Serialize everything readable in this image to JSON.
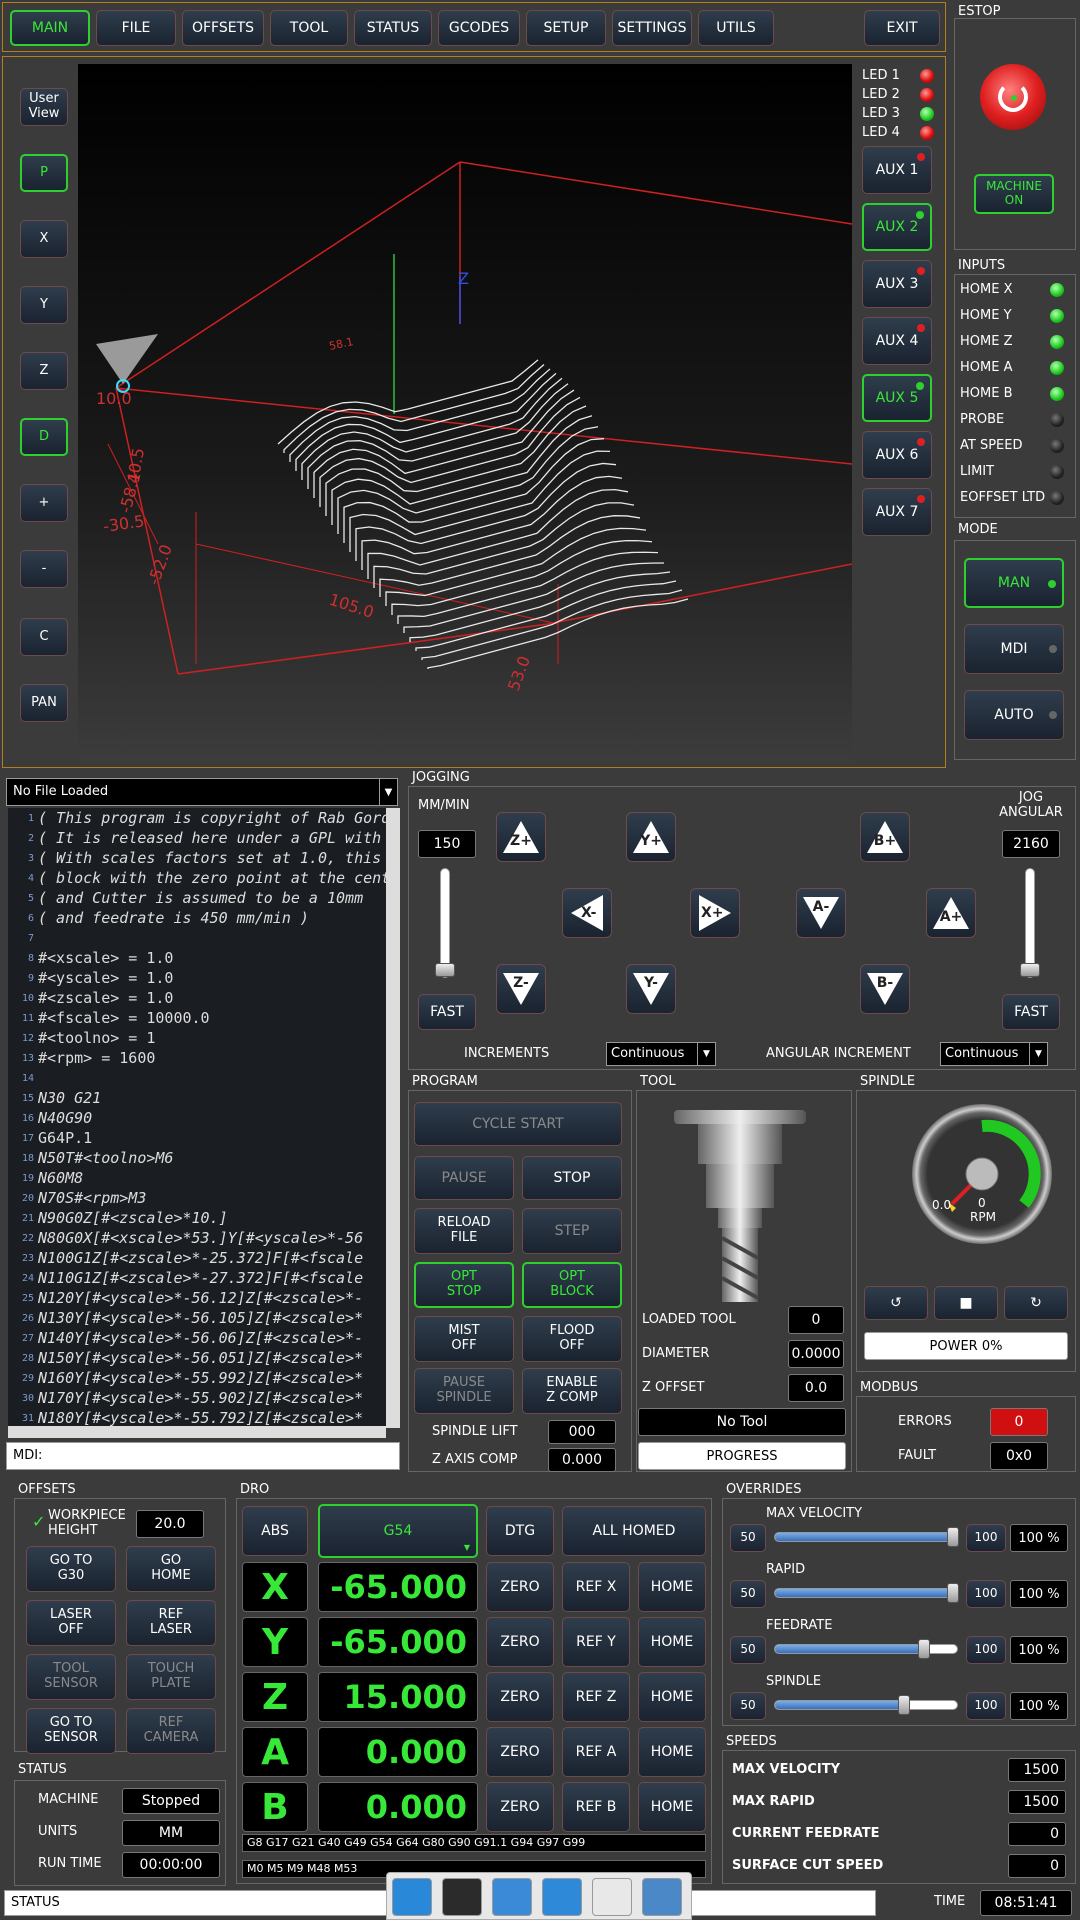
{
  "tabs": [
    "MAIN",
    "FILE",
    "OFFSETS",
    "TOOL",
    "STATUS",
    "GCODES",
    "SETUP",
    "SETTINGS",
    "UTILS"
  ],
  "exit_label": "EXIT",
  "estop": {
    "title": "ESTOP",
    "machine_on": "MACHINE\nON"
  },
  "view_buttons": [
    "User\nView",
    "P",
    "X",
    "Y",
    "Z",
    "D",
    "+",
    "-",
    "C",
    "PAN"
  ],
  "leds": [
    {
      "label": "LED 1",
      "state": "red"
    },
    {
      "label": "LED 2",
      "state": "red"
    },
    {
      "label": "LED 3",
      "state": "green"
    },
    {
      "label": "LED 4",
      "state": "red"
    }
  ],
  "aux": [
    {
      "label": "AUX 1",
      "on": false
    },
    {
      "label": "AUX 2",
      "on": true
    },
    {
      "label": "AUX 3",
      "on": false
    },
    {
      "label": "AUX 4",
      "on": false
    },
    {
      "label": "AUX 5",
      "on": true
    },
    {
      "label": "AUX 6",
      "on": false
    },
    {
      "label": "AUX 7",
      "on": false
    }
  ],
  "preview": {
    "labels": [
      "10.0",
      "58.1",
      "40.5",
      "-58.1",
      "-30.5",
      "-52.0",
      "105.0",
      "53.0",
      "Z",
      "X",
      "Y"
    ]
  },
  "inputs": {
    "title": "INPUTS",
    "items": [
      {
        "label": "HOME X",
        "state": "green"
      },
      {
        "label": "HOME Y",
        "state": "green"
      },
      {
        "label": "HOME Z",
        "state": "green"
      },
      {
        "label": "HOME A",
        "state": "green"
      },
      {
        "label": "HOME B",
        "state": "green"
      },
      {
        "label": "PROBE",
        "state": "off"
      },
      {
        "label": "AT SPEED",
        "state": "off"
      },
      {
        "label": "LIMIT",
        "state": "off"
      },
      {
        "label": "EOFFSET LTD",
        "state": "off"
      }
    ]
  },
  "mode": {
    "title": "MODE",
    "items": [
      {
        "label": "MAN",
        "on": true
      },
      {
        "label": "MDI",
        "on": false
      },
      {
        "label": "AUTO",
        "on": false
      }
    ]
  },
  "file": {
    "selected": "No File Loaded"
  },
  "gcode_lines": [
    {
      "n": "1",
      "t": "( This program is copyright of Rab Gordon"
    },
    {
      "n": "2",
      "t": "( It is released here under a GPL with"
    },
    {
      "n": "3",
      "t": "( With scales factors set at 1.0, this"
    },
    {
      "n": "4",
      "t": "( block with the zero point at the centre"
    },
    {
      "n": "5",
      "t": "( and Cutter is assumed to be a 10mm"
    },
    {
      "n": "6",
      "t": "( and feedrate is 450 mm/min )"
    },
    {
      "n": "7",
      "t": ""
    },
    {
      "n": "8",
      "t": "#<xscale> = 1.0"
    },
    {
      "n": "9",
      "t": "#<yscale> = 1.0"
    },
    {
      "n": "10",
      "t": "#<zscale> = 1.0"
    },
    {
      "n": "11",
      "t": "#<fscale> = 10000.0"
    },
    {
      "n": "12",
      "t": "#<toolno> = 1"
    },
    {
      "n": "13",
      "t": "#<rpm>    = 1600"
    },
    {
      "n": "14",
      "t": ""
    },
    {
      "n": "15",
      "t": "N30 G21"
    },
    {
      "n": "16",
      "t": "N40G90"
    },
    {
      "n": "17",
      "t": "G64P.1"
    },
    {
      "n": "18",
      "t": "N50T#<toolno>M6"
    },
    {
      "n": "19",
      "t": "N60M8"
    },
    {
      "n": "20",
      "t": "N70S#<rpm>M3"
    },
    {
      "n": "21",
      "t": "N90G0Z[#<zscale>*10.]"
    },
    {
      "n": "22",
      "t": "N80G0X[#<xscale>*53.]Y[#<yscale>*-56"
    },
    {
      "n": "23",
      "t": "N100G1Z[#<zscale>*-25.372]F[#<fscale"
    },
    {
      "n": "24",
      "t": "N110G1Z[#<zscale>*-27.372]F[#<fscale"
    },
    {
      "n": "25",
      "t": "N120Y[#<yscale>*-56.12]Z[#<zscale>*-"
    },
    {
      "n": "26",
      "t": "N130Y[#<yscale>*-56.105]Z[#<zscale>*"
    },
    {
      "n": "27",
      "t": "N140Y[#<yscale>*-56.06]Z[#<zscale>*-"
    },
    {
      "n": "28",
      "t": "N150Y[#<yscale>*-56.051]Z[#<zscale>*"
    },
    {
      "n": "29",
      "t": "N160Y[#<yscale>*-55.992]Z[#<zscale>*"
    },
    {
      "n": "30",
      "t": "N170Y[#<yscale>*-55.902]Z[#<zscale>*"
    },
    {
      "n": "31",
      "t": "N180Y[#<yscale>*-55.792]Z[#<zscale>*"
    }
  ],
  "mdi": {
    "label": "MDI:"
  },
  "jogging": {
    "title": "JOGGING",
    "units": "MM/MIN",
    "rate": "150",
    "ang_title": "JOG\nANGULAR",
    "ang_rate": "2160",
    "fast": "FAST",
    "increments_label": "INCREMENTS",
    "increments_value": "Continuous",
    "ang_inc_label": "ANGULAR INCREMENT",
    "ang_inc_value": "Continuous",
    "buttons": {
      "zp": "Z+",
      "yp": "Y+",
      "bp": "B+",
      "xm": "X-",
      "xp": "X+",
      "am": "A-",
      "ap": "A+",
      "zm": "Z-",
      "ym": "Y-",
      "bm": "B-"
    }
  },
  "program": {
    "title": "PROGRAM",
    "cycle_start": "CYCLE START",
    "pause": "PAUSE",
    "stop": "STOP",
    "reload": "RELOAD\nFILE",
    "step": "STEP",
    "opt_stop": "OPT\nSTOP",
    "opt_block": "OPT\nBLOCK",
    "mist": "MIST\nOFF",
    "flood": "FLOOD\nOFF",
    "pause_spindle": "PAUSE\nSPINDLE",
    "enable_zcomp": "ENABLE\nZ COMP",
    "spindle_lift_label": "SPINDLE LIFT",
    "spindle_lift": "000",
    "zcomp_label": "Z AXIS COMP",
    "zcomp": "0.000"
  },
  "tool": {
    "title": "TOOL",
    "loaded_label": "LOADED TOOL",
    "loaded": "0",
    "diameter_label": "DIAMETER",
    "diameter": "0.0000",
    "zoffset_label": "Z OFFSET",
    "zoffset": "0.0",
    "no_tool": "No Tool",
    "progress": "PROGRESS"
  },
  "spindle": {
    "title": "SPINDLE",
    "gauge_value": "0.0",
    "rpm_value": "0",
    "rpm_label": "RPM",
    "power": "POWER 0%"
  },
  "modbus": {
    "title": "MODBUS",
    "errors_label": "ERRORS",
    "errors": "0",
    "fault_label": "FAULT",
    "fault": "0x0"
  },
  "offsets": {
    "title": "OFFSETS",
    "wp_height_label": "WORKPIECE\nHEIGHT",
    "wp_height": "20.0",
    "buttons": [
      [
        "GO TO\nG30",
        "GO\nHOME"
      ],
      [
        "LASER\nOFF",
        "REF\nLASER"
      ],
      [
        "TOOL\nSENSOR",
        "TOUCH\nPLATE"
      ],
      [
        "GO TO\nSENSOR",
        "REF\nCAMERA"
      ]
    ]
  },
  "dro": {
    "title": "DRO",
    "abs": "ABS",
    "wcs": "G54",
    "dtg": "DTG",
    "all_homed": "ALL HOMED",
    "axes": [
      {
        "name": "X",
        "value": "-65.000",
        "ref": "REF X"
      },
      {
        "name": "Y",
        "value": "-65.000",
        "ref": "REF Y"
      },
      {
        "name": "Z",
        "value": "15.000",
        "ref": "REF Z"
      },
      {
        "name": "A",
        "value": "0.000",
        "ref": "REF A"
      },
      {
        "name": "B",
        "value": "0.000",
        "ref": "REF B"
      }
    ],
    "zero": "ZERO",
    "home": "HOME",
    "gcodes": "G8 G17 G21 G40 G49 G54 G64 G80 G90 G91.1 G94 G97 G99",
    "mcodes": "M0 M5 M9 M48 M53"
  },
  "overrides": {
    "title": "OVERRIDES",
    "items": [
      {
        "label": "MAX VELOCITY",
        "low": "50",
        "high": "100",
        "value": "100 %",
        "fraction": 0.97
      },
      {
        "label": "RAPID",
        "low": "50",
        "high": "100",
        "value": "100 %",
        "fraction": 0.97
      },
      {
        "label": "FEEDRATE",
        "low": "50",
        "high": "100",
        "value": "100 %",
        "fraction": 0.81
      },
      {
        "label": "SPINDLE",
        "low": "50",
        "high": "100",
        "value": "100 %",
        "fraction": 0.7
      }
    ]
  },
  "speeds": {
    "title": "SPEEDS",
    "items": [
      {
        "label": "MAX VELOCITY",
        "value": "1500"
      },
      {
        "label": "MAX RAPID",
        "value": "1500"
      },
      {
        "label": "CURRENT FEEDRATE",
        "value": "0"
      },
      {
        "label": "SURFACE CUT SPEED",
        "value": "0"
      }
    ]
  },
  "status": {
    "title": "STATUS",
    "items": [
      {
        "label": "MACHINE",
        "value": "Stopped"
      },
      {
        "label": "UNITS",
        "value": "MM"
      },
      {
        "label": "RUN TIME",
        "value": "00:00:00"
      }
    ]
  },
  "statusbar": {
    "label": "STATUS",
    "time_label": "TIME",
    "time": "08:51:41"
  },
  "taskbar": [
    "desktop-icon",
    "terminal-icon",
    "text-editor-icon",
    "browser-globe-icon",
    "search-icon",
    "folder-icon"
  ]
}
